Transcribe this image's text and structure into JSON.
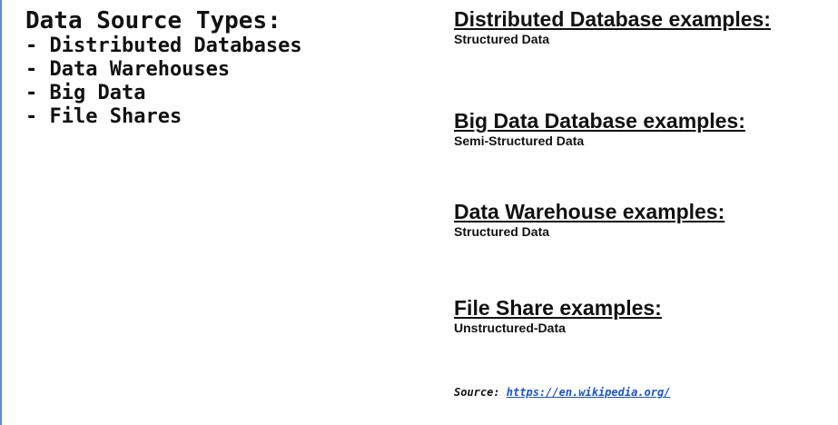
{
  "left": {
    "title": "Data Source Types:",
    "items": [
      "- Distributed Databases",
      "- Data Warehouses",
      "- Big Data",
      "- File Shares"
    ]
  },
  "examples": [
    {
      "heading": "Distributed Database examples:",
      "subtitle": "Structured Data"
    },
    {
      "heading": "Big Data Database examples:",
      "subtitle": "Semi-Structured Data"
    },
    {
      "heading": "Data Warehouse examples:",
      "subtitle": "Structured Data"
    },
    {
      "heading": "File Share examples:",
      "subtitle": "Unstructured-Data"
    }
  ],
  "source": {
    "label": "Source:",
    "link_text": "https://en.wikipedia.org/"
  },
  "colors": {
    "border": "#5b8fc7",
    "link": "#1a55c8",
    "text": "#111111"
  }
}
